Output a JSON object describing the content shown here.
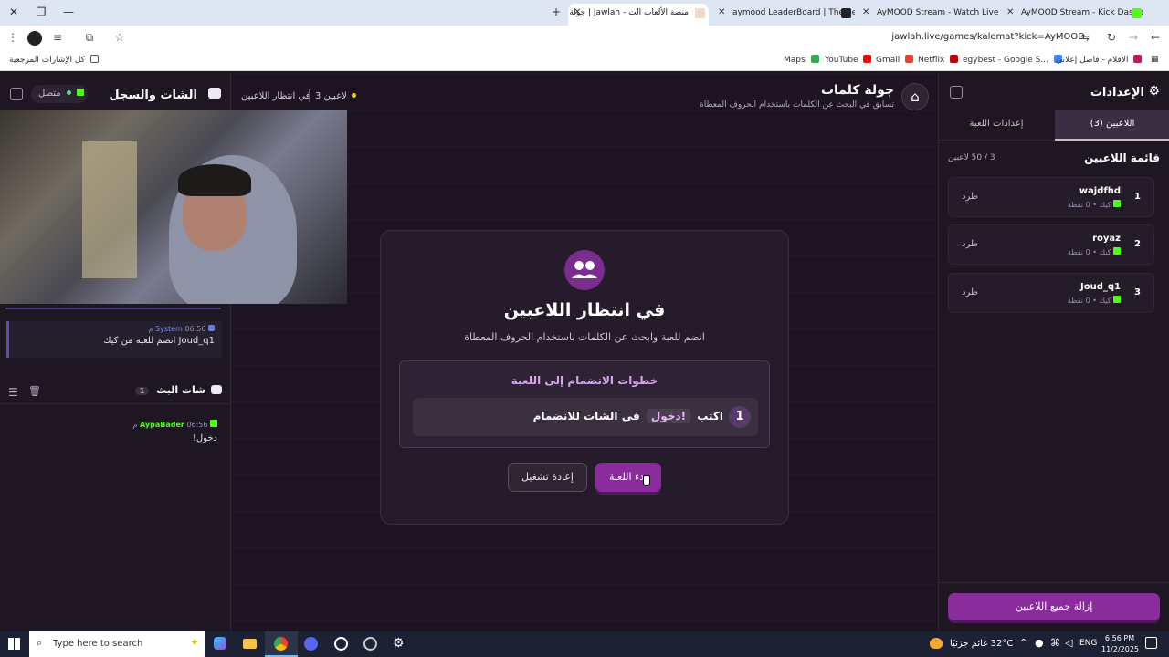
{
  "browser": {
    "tabs": [
      {
        "title": "جولة | Jawlah - منصة الألعاب الت",
        "active": true
      },
      {
        "title": "aymood LeaderBoard | The be",
        "active": false
      },
      {
        "title": "AyMOOD Stream - Watch Live",
        "active": false
      },
      {
        "title": "AyMOOD Stream - Kick Dashb",
        "active": false
      }
    ],
    "url": "jawlah.live/games/kalemat?kick=AyMOOD",
    "bookmarks": [
      "Maps",
      "YouTube",
      "Gmail",
      "Netflix",
      "egybest - Google S...",
      "الأفلام - فاصل إعلاني"
    ],
    "bookmarks_all": "كل الإشارات المرجعية"
  },
  "left_panel": {
    "title": "الشات والسجل",
    "status": "متصل",
    "log": [
      {
        "author": "System",
        "time": "06:56 م",
        "text": "Joud_q1 انضم للعبة من كيك"
      }
    ],
    "chat_title": "شات البث",
    "chat_count": "1",
    "messages": [
      {
        "author": "AypaBader",
        "time": "06:56 م",
        "text": "دخول!"
      }
    ]
  },
  "header": {
    "title": "جولة كلمات",
    "subtitle": "تسابق في البحث عن الكلمات باستخدام الحروف المعطاة",
    "players_count": "3 لاعبين",
    "state": "في انتظار اللاعبين"
  },
  "card": {
    "title": "في انتظار اللاعبين",
    "subtitle": "انضم للعبة وابحث عن الكلمات باستخدام الحروف المعطاة",
    "steps_title": "خطوات الانضمام إلى اللعبة",
    "step_number": "1",
    "step_prefix": "اكتب",
    "step_command": "!دخول",
    "step_suffix": "في الشات للانضمام",
    "start_label": "بدء اللعبة",
    "reset_label": "إعادة تشغيل"
  },
  "settings": {
    "title": "الإعدادات",
    "tab_players": "اللاعبين (3)",
    "tab_game": "إعدادات اللعبة",
    "list_title": "قائمة اللاعبين",
    "capacity": "3 / 50 لاعبين",
    "kick_label": "طرد",
    "platform": "كيك",
    "players": [
      {
        "rank": "1",
        "name": "wajdfhd",
        "points": "0 نقطة"
      },
      {
        "rank": "2",
        "name": "royaz",
        "points": "0 نقطة"
      },
      {
        "rank": "3",
        "name": "Joud_q1",
        "points": "0 نقطة"
      }
    ],
    "remove_all": "إزالة جميع اللاعبين"
  },
  "taskbar": {
    "search_placeholder": "Type here to search",
    "weather": "32°C  غائم جزئيًا",
    "lang": "ENG",
    "time": "6:56 PM",
    "date": "11/2/2025"
  }
}
